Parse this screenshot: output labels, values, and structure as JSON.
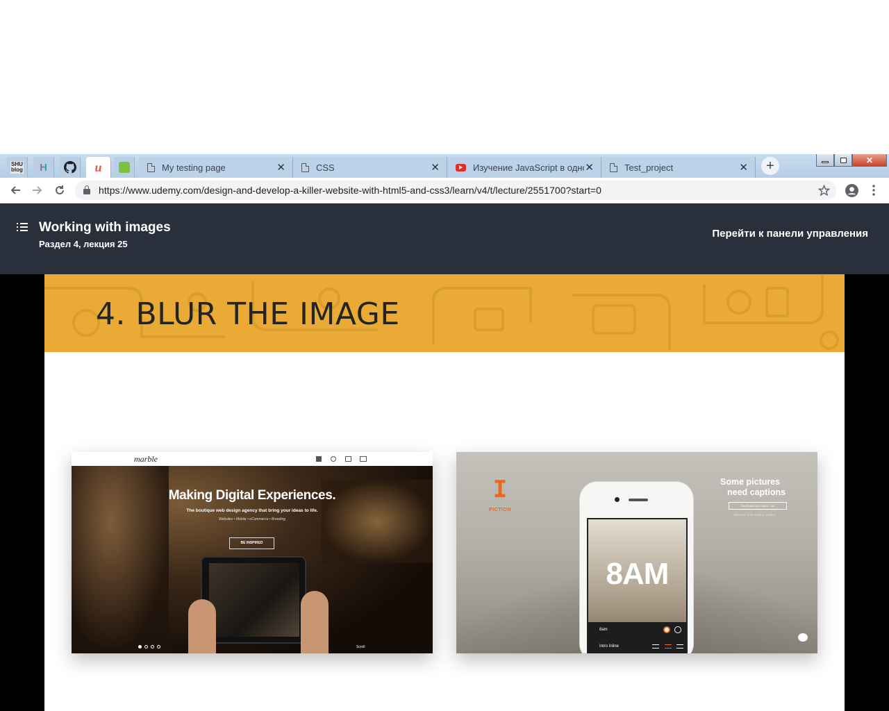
{
  "browser": {
    "pinned_tabs": [
      "SHU blog",
      "H",
      "GitHub",
      "Udemy",
      "Evernote"
    ],
    "tabs": [
      {
        "title": "My testing page",
        "icon": "document-icon"
      },
      {
        "title": "CSS",
        "icon": "document-icon"
      },
      {
        "title": "Изучение JavaScript в одном",
        "icon": "youtube-icon"
      },
      {
        "title": "Test_project",
        "icon": "document-icon"
      }
    ],
    "close_glyph": "✕",
    "new_tab_glyph": "+",
    "url": "https://www.udemy.com/design-and-develop-a-killer-website-with-html5-and-css3/learn/v4/t/lecture/2551700?start=0"
  },
  "header": {
    "lecture_title": "Working with images",
    "lecture_subtitle": "Раздел 4, лекция 25",
    "dashboard_link": "Перейти к панели управления"
  },
  "slide": {
    "banner_title": "4. BLUR THE IMAGE",
    "example1": {
      "logo": "marble",
      "headline": "Making Digital Experiences.",
      "tagline": "The boutique web design agency that bring your ideas to life.",
      "services": "Websites • Mobile • eCommerce • Branding",
      "cta": "BE INSPIRED",
      "scroll": "Scroll"
    },
    "example2": {
      "brand": "PICTION",
      "headline1": "Some pictures",
      "headline2": "need captions",
      "button": "Get Piction for iPhone - We",
      "video": "WATCH THE DEMO VIDEO",
      "phone_caption": "8AM",
      "phone_row1": "8am",
      "phone_row2": "Intro Inline"
    }
  }
}
